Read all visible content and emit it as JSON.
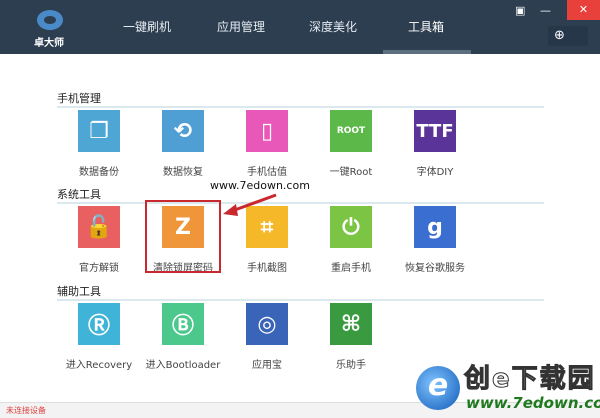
{
  "app": {
    "logo_text": "卓大师"
  },
  "tabs": [
    "一键刷机",
    "应用管理",
    "深度美化",
    "工具箱"
  ],
  "active_tab": "工具箱",
  "window": {
    "restore": "▣",
    "minimize": "—",
    "close": "✕",
    "download": "⊕"
  },
  "sections": [
    {
      "title": "手机管理",
      "tools": [
        {
          "label": "数据备份",
          "color": "#4da6d4",
          "glyph": "❐"
        },
        {
          "label": "数据恢复",
          "color": "#4f9fd4",
          "glyph": "⟲"
        },
        {
          "label": "手机估值",
          "color": "#e858b8",
          "glyph": "▯"
        },
        {
          "label": "一键Root",
          "color": "#5cb848",
          "glyph": "ROOT"
        },
        {
          "label": "字体DIY",
          "color": "#5a3498",
          "glyph": "TTF"
        }
      ]
    },
    {
      "title": "系统工具",
      "tools": [
        {
          "label": "官方解锁",
          "color": "#e86060",
          "glyph": "🔓"
        },
        {
          "label": "清除锁屏密码",
          "color": "#f0963a",
          "glyph": "Z"
        },
        {
          "label": "手机截图",
          "color": "#f4b828",
          "glyph": "⌗"
        },
        {
          "label": "重启手机",
          "color": "#7cc444",
          "glyph": "⏻"
        },
        {
          "label": "恢复谷歌服务",
          "color": "#3a6ed0",
          "glyph": "g"
        }
      ]
    },
    {
      "title": "辅助工具",
      "tools": [
        {
          "label": "进入Recovery",
          "color": "#40b4d8",
          "glyph": "Ⓡ"
        },
        {
          "label": "进入Bootloader",
          "color": "#4cc88c",
          "glyph": "Ⓑ"
        },
        {
          "label": "应用宝",
          "color": "#3a64b8",
          "glyph": "◎"
        },
        {
          "label": "乐助手",
          "color": "#3a9a40",
          "glyph": "⌘"
        }
      ]
    }
  ],
  "watermark": "www.7edown.com",
  "status": "未连接设备",
  "brand": {
    "cn": "创e下载园",
    "url": "www.7edown.com"
  }
}
